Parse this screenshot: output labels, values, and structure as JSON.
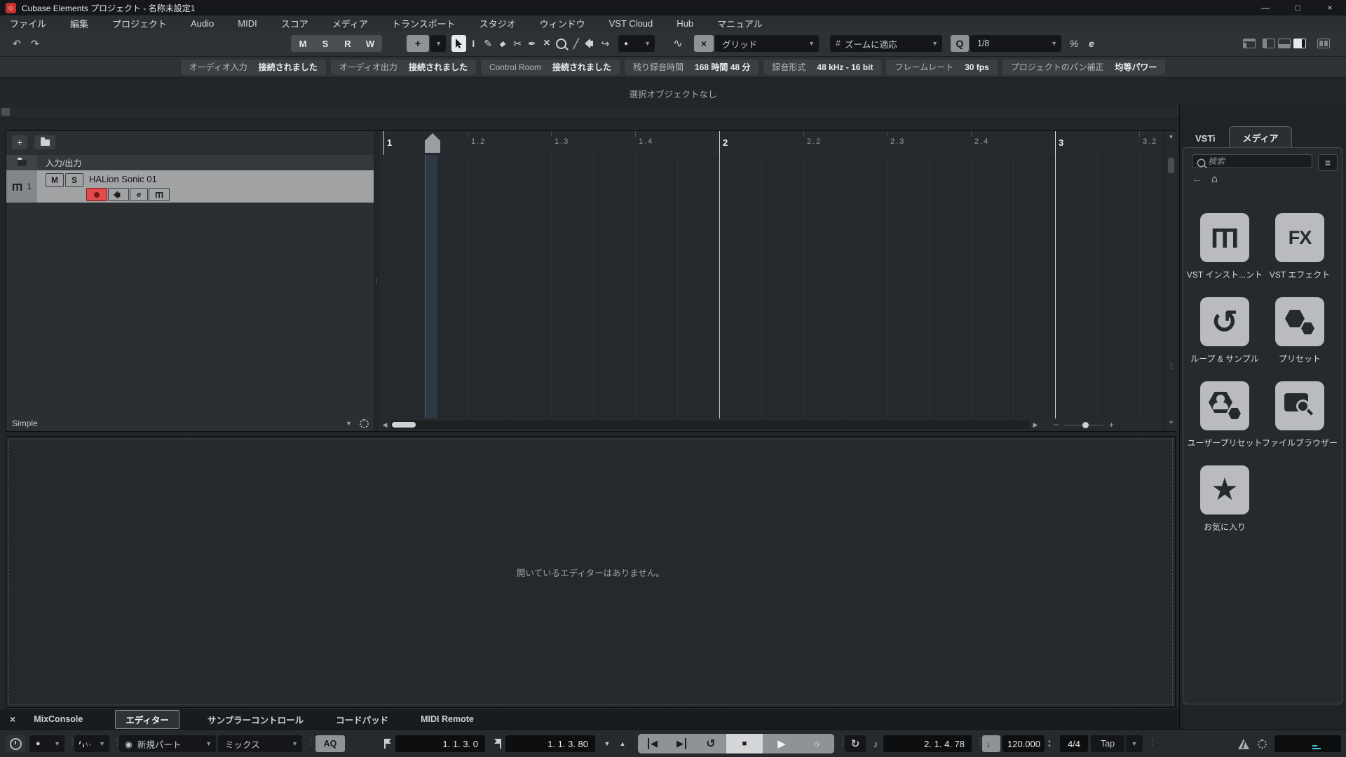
{
  "title_bar": {
    "title": "Cubase Elements プロジェクト - 名称未設定1"
  },
  "menu_bar": {
    "items": [
      "ファイル",
      "編集",
      "プロジェクト",
      "Audio",
      "MIDI",
      "スコア",
      "メディア",
      "トランスポート",
      "スタジオ",
      "ウィンドウ",
      "VST Cloud",
      "Hub",
      "マニュアル"
    ]
  },
  "toolbar": {
    "m": "M",
    "s": "S",
    "r": "R",
    "w": "W",
    "grid_mode": "グリッド",
    "grid_type": "ズームに適応",
    "quantize_label": "Q",
    "quantize_value": "1/8"
  },
  "info_bar": {
    "chips": [
      {
        "label": "オーディオ入力",
        "value": "接続されました"
      },
      {
        "label": "オーディオ出力",
        "value": "接続されました"
      },
      {
        "label": "Control Room",
        "value": "接続されました"
      },
      {
        "label": "残り録音時間",
        "value": "168 時間 48 分"
      },
      {
        "label": "録音形式",
        "value": "48 kHz - 16 bit"
      },
      {
        "label": "フレームレート",
        "value": "30 fps"
      },
      {
        "label": "プロジェクトのパン補正",
        "value": "均等パワー"
      }
    ]
  },
  "status_line": {
    "text": "選択オブジェクトなし"
  },
  "track_list": {
    "io_row_label": "入力/出力",
    "track": {
      "number": "1",
      "mute": "M",
      "solo": "S",
      "name": "HALion Sonic 01",
      "edit": "e"
    },
    "preset_name": "Simple"
  },
  "ruler": {
    "ticks": [
      "1",
      "1.2",
      "1.3",
      "1.4",
      "2",
      "2.2",
      "2.3",
      "2.4",
      "3",
      "3.2"
    ]
  },
  "lower_zone": {
    "empty_text": "開いているエディターはありません。",
    "tabs": [
      "MixConsole",
      "エディター",
      "サンプラーコントロール",
      "コードパッド",
      "MIDI Remote"
    ]
  },
  "right_panel": {
    "tab_vsti": "VSTi",
    "tab_media": "メディア",
    "search_placeholder": "検索",
    "fx_text": "FX",
    "tiles": [
      {
        "label": "VST インスト...ント"
      },
      {
        "label": "VST エフェクト"
      },
      {
        "label": "ループ & サンプル"
      },
      {
        "label": "プリセット"
      },
      {
        "label": "ユーザープリセット"
      },
      {
        "label": "ファイルブラウザー"
      },
      {
        "label": "お気に入り"
      }
    ]
  },
  "transport": {
    "new_part": "新規パート",
    "mix": "ミックス",
    "aq": "AQ",
    "left_locator": "1. 1. 3. 0",
    "right_locator": "1. 1. 3. 80",
    "position": "2. 1. 4. 78",
    "tempo": "120.000",
    "time_sig": "4/4",
    "tap": "Tap"
  },
  "icons": {
    "undo": "↶",
    "redo": "↷",
    "autoscroll": "+",
    "dropdown": "▼",
    "range_tool": "I",
    "pencil": "✎",
    "eraser": "◆",
    "scissors": "✂",
    "glue": "✒",
    "mute": "×",
    "line": "╱",
    "color_tool": "↪",
    "color_dot": "●",
    "automation": "∿",
    "snap": "×",
    "hash": "#",
    "percent": "%",
    "e_button": "e",
    "add": "+",
    "back": "←",
    "home": "⌂",
    "list": "≡",
    "star": "★",
    "loop": "↺",
    "piano": "Ш",
    "midi_din": "◉",
    "note": "♪",
    "quarter": "♩",
    "to_start": "◀",
    "to_end": "▶",
    "cycle": "↺",
    "stop": "■",
    "play": "▶",
    "record": "○",
    "retro_record": "↻",
    "spin_up": "▲",
    "spin_down": "▼",
    "punch_in": "▼",
    "punch_out": "▲",
    "close": "×",
    "minimize": "—",
    "maximize": "□",
    "vdots": "⋮",
    "scroll_left": "◀",
    "scroll_right": "▶",
    "minus": "−",
    "plus2": "+",
    "logo": "◇"
  },
  "colors": {
    "accent_red": "#e04a4a",
    "selected_track": "#a0a2a4",
    "tile_bg": "#b9bbbe",
    "activity_cyan": "#49c3d6"
  }
}
